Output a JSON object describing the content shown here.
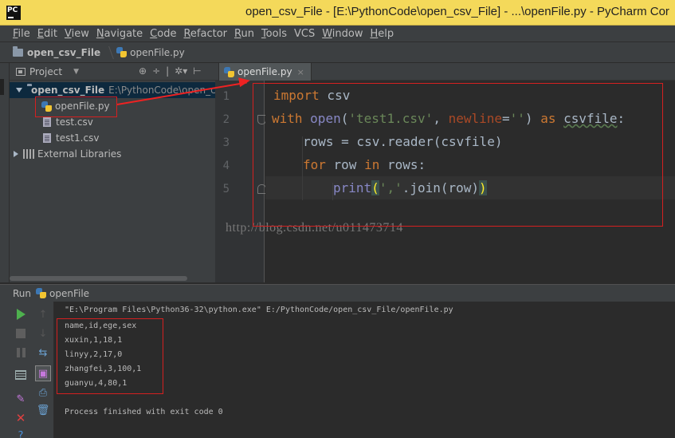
{
  "window": {
    "title": "open_csv_File - [E:\\PythonCode\\open_csv_File] - ...\\openFile.py - PyCharm Cor"
  },
  "menu": [
    {
      "u": "F",
      "rest": "ile"
    },
    {
      "u": "E",
      "rest": "dit"
    },
    {
      "u": "V",
      "rest": "iew"
    },
    {
      "u": "N",
      "rest": "avigate"
    },
    {
      "u": "C",
      "rest": "ode"
    },
    {
      "u": "R",
      "rest": "efactor"
    },
    {
      "u": "R",
      "rest": "un"
    },
    {
      "u": "T",
      "rest": "ools"
    },
    {
      "u": "",
      "rest": "VCS"
    },
    {
      "u": "W",
      "rest": "indow"
    },
    {
      "u": "H",
      "rest": "elp"
    }
  ],
  "breadcrumb": {
    "project": "open_csv_File",
    "file": "openFile.py"
  },
  "project_panel": {
    "title": "Project",
    "root_name": "open_csv_File",
    "root_path": "E:\\PythonCode\\open_c",
    "files": [
      "openFile.py",
      "test.csv",
      "test1.csv"
    ],
    "external": "External Libraries"
  },
  "editor": {
    "tab_label": "openFile.py",
    "line_numbers": [
      "1",
      "2",
      "3",
      "4",
      "5"
    ],
    "code": {
      "l1_kw": "import",
      "l1_rest": " csv",
      "l2_kw": "with",
      "l2_fn": "open",
      "l2_str1": "'test1.csv'",
      "l2_param": "newline",
      "l2_str2": "''",
      "l2_as": "as",
      "l2_var": "csvfile",
      "l3": "rows = csv.reader(csvfile)",
      "l4_for": "for",
      "l4_row": " row ",
      "l4_in": "in",
      "l4_rest": " rows:",
      "l5_fn": "print",
      "l5_str": "','",
      "l5_rest": ".join(row)"
    },
    "watermark": "http://blog.csdn.net/u011473714"
  },
  "run_panel": {
    "title": "Run",
    "config": "openFile",
    "command": "\"E:\\Program Files\\Python36-32\\python.exe\" E:/PythonCode/open_csv_File/openFile.py",
    "output": [
      "name,id,ege,sex",
      "xuxin,1,18,1",
      "linyy,2,17,0",
      "zhangfei,3,100,1",
      "guanyu,4,80,1"
    ],
    "exit_msg": "Process finished with exit code 0"
  },
  "colors": {
    "title_bar": "#f4d95a",
    "keyword": "#cc7832",
    "string": "#6a8759",
    "annotation": "#e22222"
  }
}
